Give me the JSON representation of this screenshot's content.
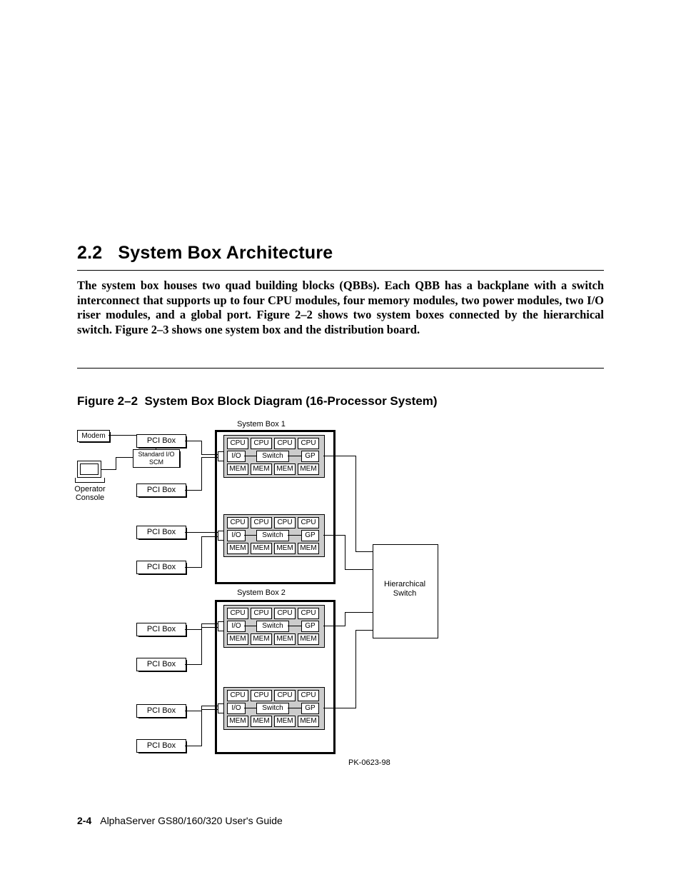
{
  "section": {
    "number": "2.2",
    "title": "System Box Architecture"
  },
  "intro_text": "The system box houses two quad building blocks (QBBs).  Each QBB has a backplane with a switch interconnect that supports up to four CPU modules, four memory modules, two power modules, two I/O riser modules, and a global port. Figure 2–2 shows two system boxes connected by the hierarchical switch. Figure 2–3 shows one system box and the distribution board.",
  "figure": {
    "label": "Figure 2–2",
    "title": "System Box Block Diagram (16-Processor System)"
  },
  "diagram": {
    "sysbox1_label": "System Box 1",
    "sysbox2_label": "System Box 2",
    "modem": "Modem",
    "std_io": "Standard I/O SCM",
    "operator_console_l1": "Operator",
    "operator_console_l2": "Console",
    "pci_box": "PCI Box",
    "hs_l1": "Hierarchical",
    "hs_l2": "Switch",
    "qbb": {
      "cpu": "CPU",
      "io": "I/O",
      "switch": "Switch",
      "gp": "GP",
      "mem": "MEM"
    },
    "drawing_id": "PK-0623-98"
  },
  "footer": {
    "page": "2-4",
    "doc_title": "AlphaServer GS80/160/320 User's Guide"
  }
}
